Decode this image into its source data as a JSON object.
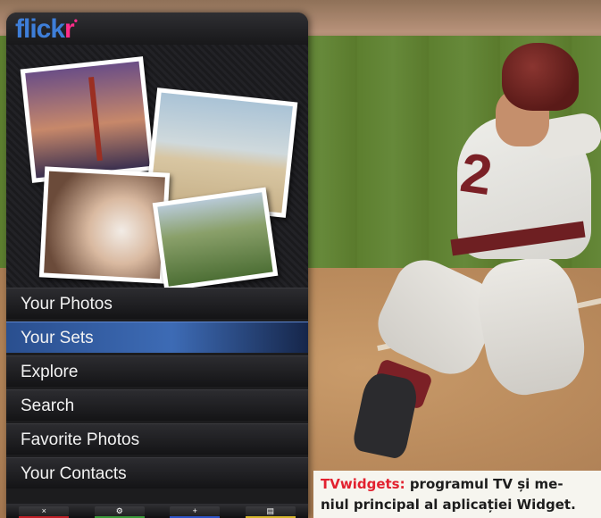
{
  "app": {
    "logo_main": "flick",
    "logo_accent": "r"
  },
  "colors": {
    "flickr_blue": "#3e7ed8",
    "flickr_pink": "#ff2d8a",
    "selection": "#3d6bb5",
    "caption_tag": "#e2212f"
  },
  "background": {
    "jersey_number": "2"
  },
  "menu": {
    "items": [
      {
        "label": "Your Photos",
        "selected": false
      },
      {
        "label": "Your Sets",
        "selected": true
      },
      {
        "label": "Explore",
        "selected": false
      },
      {
        "label": "Search",
        "selected": false
      },
      {
        "label": "Favorite Photos",
        "selected": false
      },
      {
        "label": "Your Contacts",
        "selected": false
      }
    ]
  },
  "soft_keys": [
    {
      "color": "red",
      "symbol": "×",
      "icon": "close-icon"
    },
    {
      "color": "green",
      "symbol": "⚙",
      "icon": "gear-icon"
    },
    {
      "color": "blue",
      "symbol": "+",
      "icon": "plus-icon"
    },
    {
      "color": "yellow",
      "symbol": "▤",
      "icon": "keyboard-icon"
    }
  ],
  "caption": {
    "tag": "TVwidgets:",
    "text_line1": " programul TV și me-",
    "text_line2": "niul principal al aplicației Widget."
  }
}
